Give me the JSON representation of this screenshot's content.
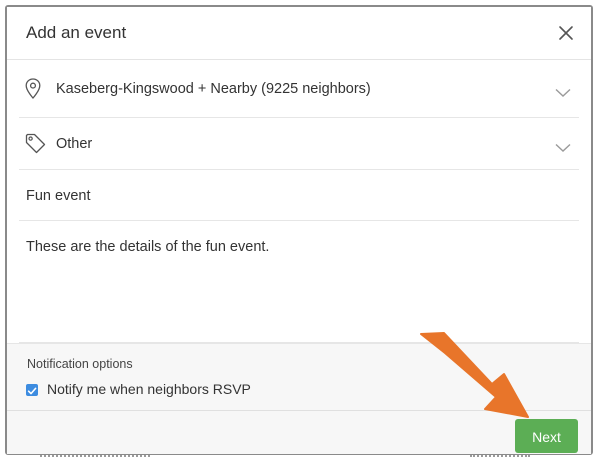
{
  "dialog": {
    "title": "Add an event",
    "close_icon": "close-icon"
  },
  "location": {
    "icon": "map-pin-icon",
    "label": "Kaseberg-Kingswood + Nearby (9225 neighbors)"
  },
  "category": {
    "icon": "tag-icon",
    "label": "Other"
  },
  "event": {
    "title": "Fun event",
    "details": "These are the details of the fun event."
  },
  "notifications": {
    "heading": "Notification options",
    "rsvp_label": "Notify me when neighbors RSVP",
    "rsvp_checked": true
  },
  "footer": {
    "next_label": "Next"
  },
  "colors": {
    "primary_button": "#5cae55",
    "checkbox": "#3d8ce0",
    "annotation_arrow": "#e8752a"
  }
}
